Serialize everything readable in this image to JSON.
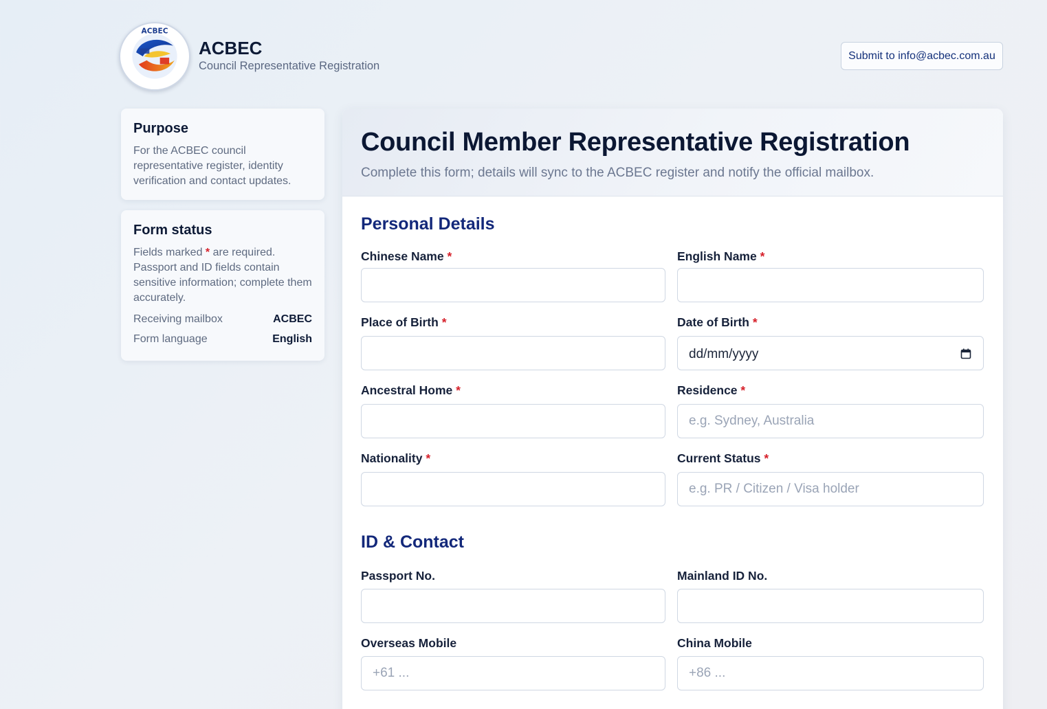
{
  "header": {
    "brand": "ACBEC",
    "subtitle": "Council Representative Registration",
    "logo_text": "ACBEC",
    "submit_label": "Submit to info@acbec.com.au"
  },
  "sidebar": {
    "purpose": {
      "title": "Purpose",
      "text": "For the ACBEC council representative register, identity verification and contact updates."
    },
    "status": {
      "title": "Form status",
      "text_before": "Fields marked ",
      "required_mark": "*",
      "text_after": " are required. Passport and ID fields contain sensitive information; complete them accurately.",
      "rows": [
        {
          "key": "Receiving mailbox",
          "value": "ACBEC"
        },
        {
          "key": "Form language",
          "value": "English"
        }
      ]
    }
  },
  "main": {
    "title": "Council Member Representative Registration",
    "subtitle": "Complete this form; details will sync to the ACBEC register and notify the official mailbox.",
    "sections": [
      {
        "title": "Personal Details"
      },
      {
        "title": "ID & Contact"
      }
    ],
    "fields": {
      "chinese_name": {
        "label": "Chinese Name",
        "required": "*",
        "value": "",
        "placeholder": ""
      },
      "english_name": {
        "label": "English Name",
        "required": "*",
        "value": "",
        "placeholder": ""
      },
      "place_of_birth": {
        "label": "Place of Birth",
        "required": "*",
        "value": "",
        "placeholder": ""
      },
      "date_of_birth": {
        "label": "Date of Birth",
        "required": "*",
        "display": "dd/mm/yyyy"
      },
      "ancestral_home": {
        "label": "Ancestral Home",
        "required": "*",
        "value": "",
        "placeholder": ""
      },
      "residence": {
        "label": "Residence",
        "required": "*",
        "value": "",
        "placeholder": "e.g. Sydney, Australia"
      },
      "nationality": {
        "label": "Nationality",
        "required": "*",
        "value": "",
        "placeholder": ""
      },
      "current_status": {
        "label": "Current Status",
        "required": "*",
        "value": "",
        "placeholder": "e.g. PR / Citizen / Visa holder"
      },
      "passport_no": {
        "label": "Passport No.",
        "value": "",
        "placeholder": ""
      },
      "mainland_id": {
        "label": "Mainland ID No.",
        "value": "",
        "placeholder": ""
      },
      "overseas_mobile": {
        "label": "Overseas Mobile",
        "value": "",
        "placeholder": "+61 ..."
      },
      "china_mobile": {
        "label": "China Mobile",
        "value": "",
        "placeholder": "+86 ..."
      }
    }
  },
  "colors": {
    "accent": "#13287a",
    "required": "#d6202a",
    "text_dark": "#0b1733"
  },
  "icons": {
    "logo": "acbec-logo-icon",
    "date": "calendar-icon"
  }
}
